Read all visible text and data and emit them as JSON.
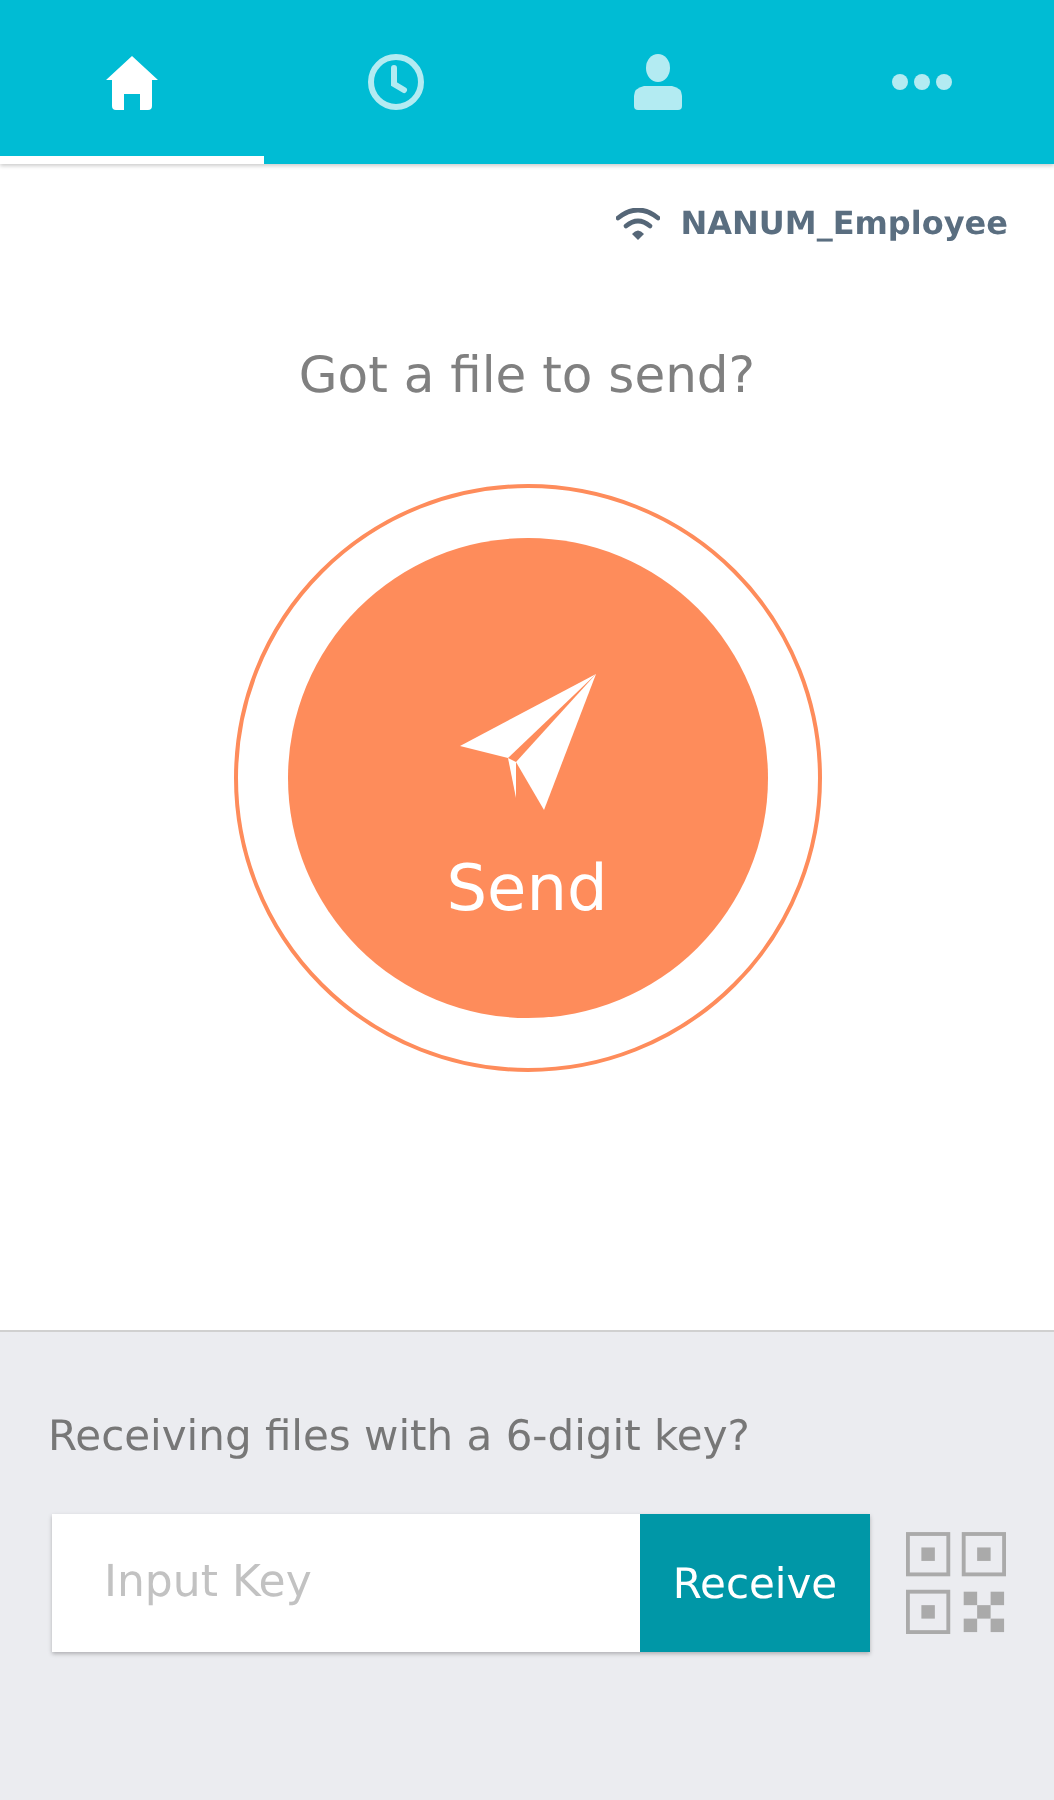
{
  "tabs": [
    {
      "kind": "home",
      "selected": true
    },
    {
      "kind": "history",
      "selected": false
    },
    {
      "kind": "profile",
      "selected": false
    },
    {
      "kind": "more",
      "selected": false
    }
  ],
  "network": {
    "name": "NANUM_Employee"
  },
  "send": {
    "prompt": "Got a file to send?",
    "button": "Send"
  },
  "receive": {
    "prompt": "Receiving files with a 6-digit key?",
    "placeholder": "Input Key",
    "button": "Receive"
  }
}
